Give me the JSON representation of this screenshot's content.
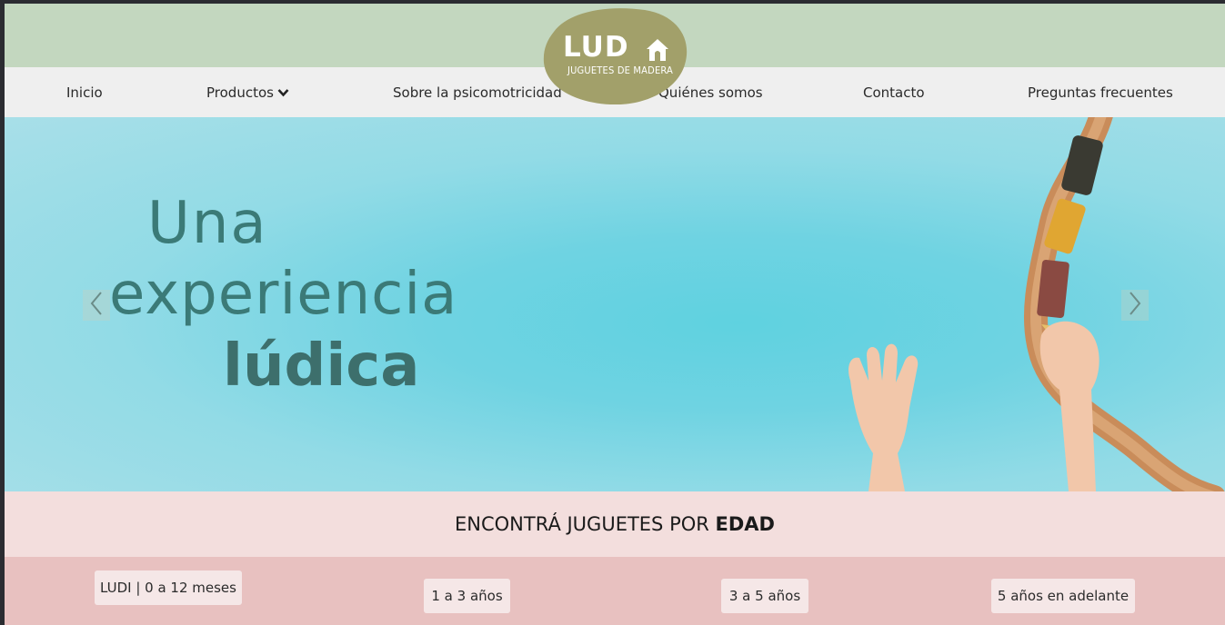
{
  "logo": {
    "word": "LUD",
    "subtitle": "JUGUETES DE MADERA",
    "color": "#a2a06a"
  },
  "nav": {
    "items": [
      {
        "label": "Inicio"
      },
      {
        "label": "Productos",
        "has_dropdown": true
      },
      {
        "label": "Sobre la psicomotricidad"
      },
      {
        "label": "Quiénes somos"
      },
      {
        "label": "Contacto"
      },
      {
        "label": "Preguntas frecuentes"
      }
    ]
  },
  "hero": {
    "line1": "Una",
    "line2": "experiencia",
    "line3": "lúdica",
    "text_color": "#3b7a77"
  },
  "age_section": {
    "title_prefix": "ENCONTRÁ JUGUETES POR ",
    "title_bold": "EDAD",
    "buttons": [
      {
        "label": "LUDI | 0 a 12 meses"
      },
      {
        "label": "1 a 3 años"
      },
      {
        "label": "3 a 5 años"
      },
      {
        "label": "5 años en adelante"
      }
    ]
  },
  "colors": {
    "topbar": "#c3d7bf",
    "navbar": "#efefef",
    "age_strip": "#f3dedd",
    "age_buttons_bg": "#e8c1c0"
  },
  "icons": [
    "chevron-down-icon",
    "chevron-left-icon",
    "chevron-right-icon",
    "house-icon"
  ]
}
